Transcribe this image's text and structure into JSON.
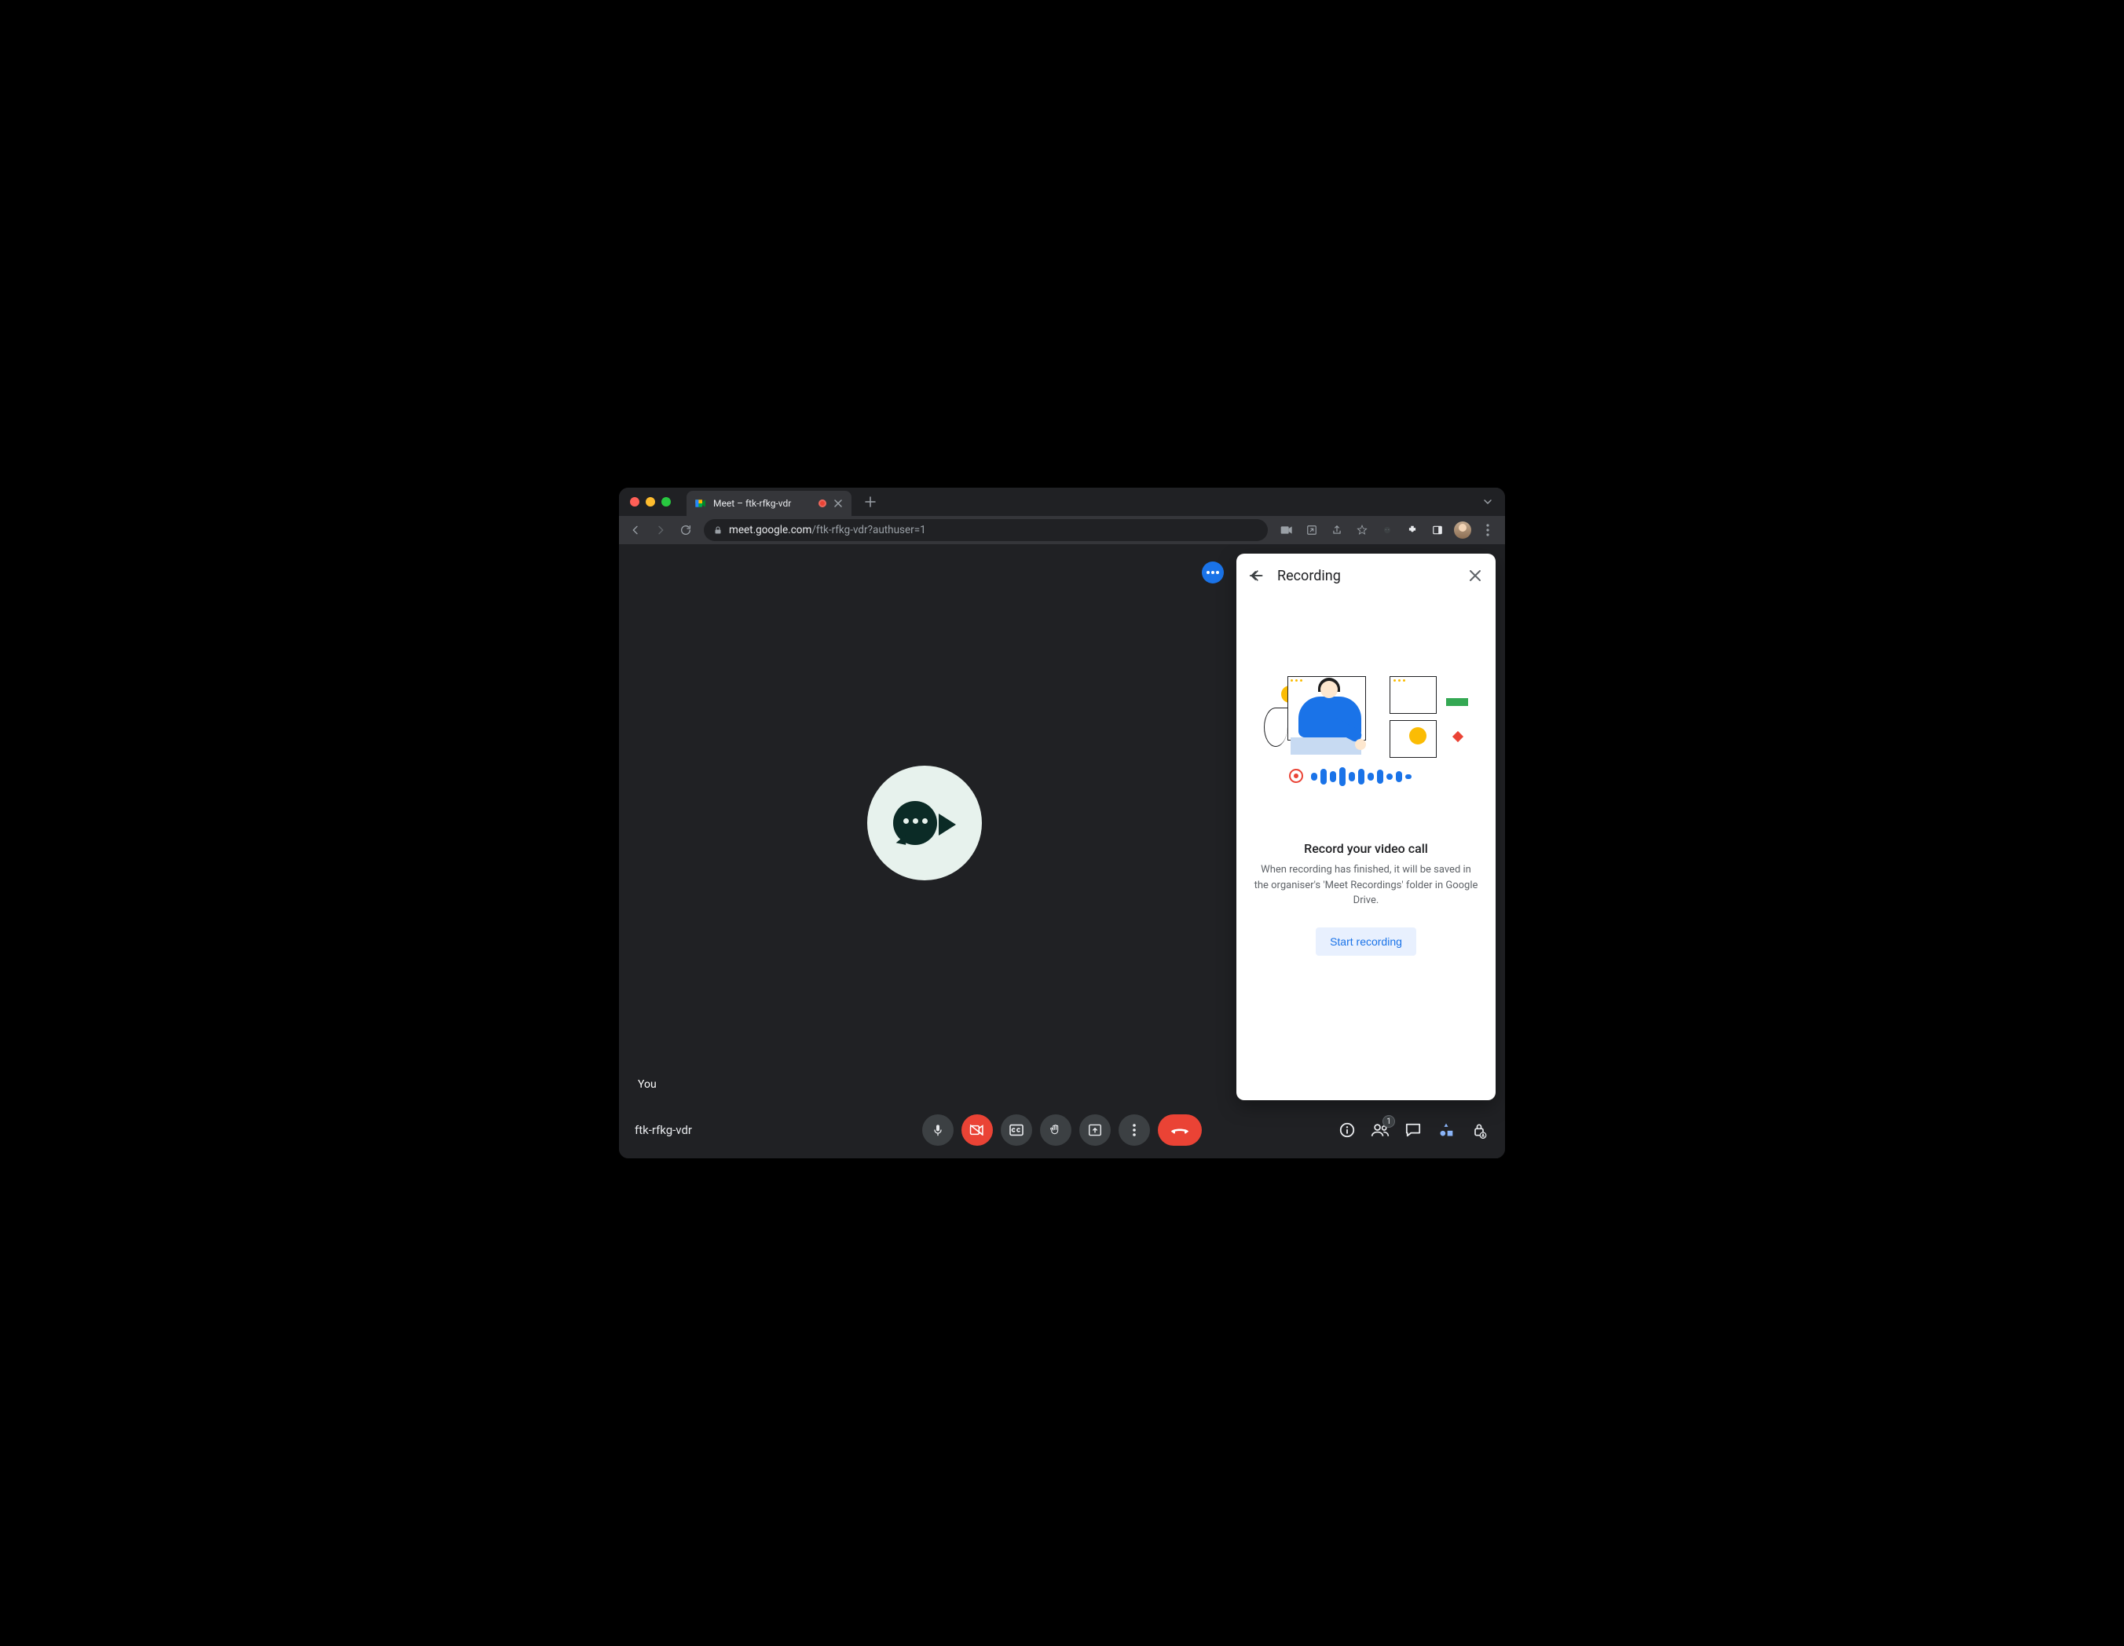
{
  "browser": {
    "tab_title": "Meet – ftk-rfkg-vdr",
    "url_host": "meet.google.com",
    "url_path": "/ftk-rfkg-vdr?authuser=1"
  },
  "meeting": {
    "code": "ftk-rfkg-vdr",
    "self_label": "You",
    "participant_count": "1"
  },
  "panel": {
    "title": "Recording",
    "heading": "Record your video call",
    "description": "When recording has finished, it will be saved in the organiser's 'Meet Recordings' folder in Google Drive.",
    "start_button": "Start recording"
  }
}
